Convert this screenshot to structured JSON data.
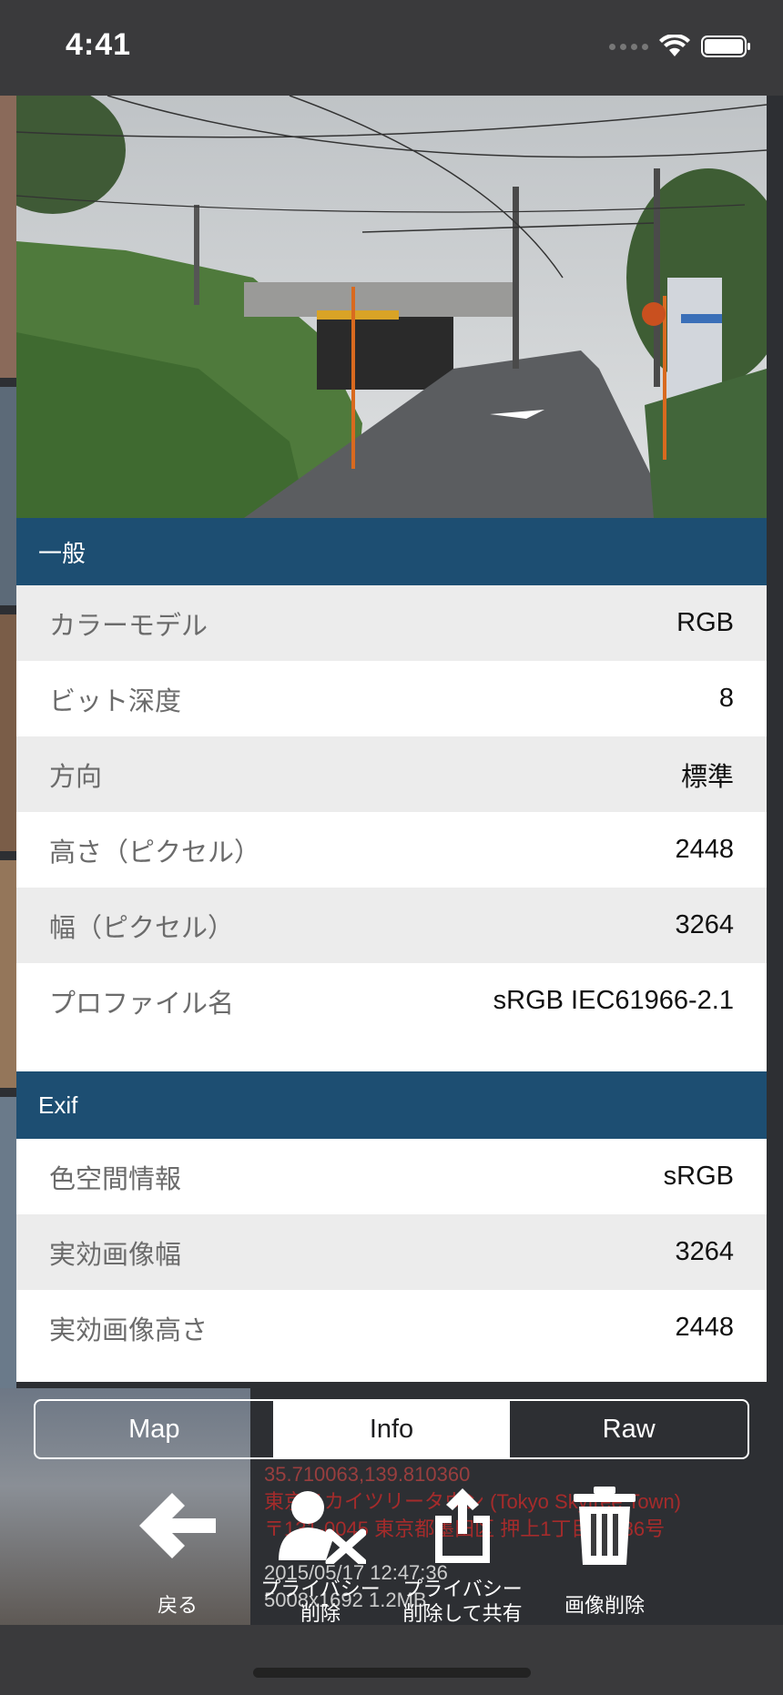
{
  "status_bar": {
    "time": "4:41"
  },
  "general": {
    "header": "一般",
    "rows": [
      {
        "label": "カラーモデル",
        "value": "RGB"
      },
      {
        "label": "ビット深度",
        "value": "8"
      },
      {
        "label": "方向",
        "value": "標準"
      },
      {
        "label": "高さ（ピクセル）",
        "value": "2448"
      },
      {
        "label": "幅（ピクセル）",
        "value": "3264"
      },
      {
        "label": "プロファイル名",
        "value": "sRGB IEC61966-2.1"
      }
    ]
  },
  "exif": {
    "header": "Exif",
    "rows": [
      {
        "label": "色空間情報",
        "value": "sRGB"
      },
      {
        "label": "実効画像幅",
        "value": "3264"
      },
      {
        "label": "実効画像高さ",
        "value": "2448"
      }
    ]
  },
  "segmented": {
    "tabs": [
      "Map",
      "Info",
      "Raw"
    ],
    "selected": "Info"
  },
  "toolbar": {
    "back": "戻る",
    "privacy_delete": "プライバシー\n削除",
    "privacy_share": "プライバシー\n削除して共有",
    "delete_image": "画像削除"
  },
  "background": {
    "coords": "35.710063,139.810360",
    "place": "東京スカイツリータウン (Tokyo Skytree Town)",
    "address": "〒131-0045 東京都墨田区 押上1丁目1番86号",
    "datetime": "2015/05/17 12:47:36",
    "size": "5008x1692 1.2MB"
  },
  "colors": {
    "header": "#1d4e72",
    "row_alt": "#ececec",
    "meta_red": "#b32b2b"
  }
}
